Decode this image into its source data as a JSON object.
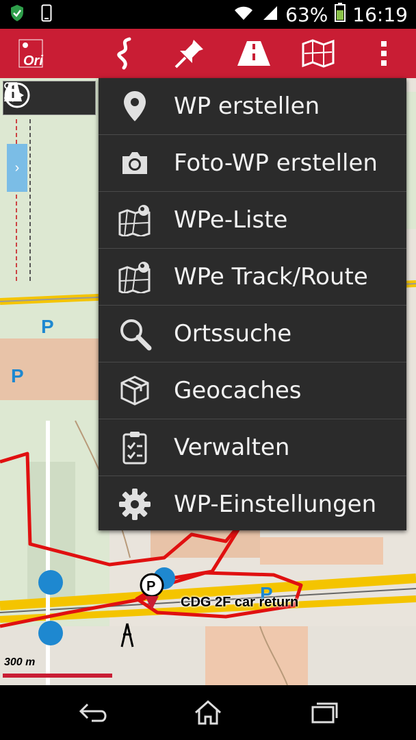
{
  "status_bar": {
    "battery_percent": "63%",
    "time": "16:19",
    "icons": [
      "shield-check-icon",
      "phone-outline-icon",
      "wifi-icon",
      "signal-icon",
      "battery-icon"
    ]
  },
  "app_bar": {
    "logo_text": "Ori",
    "tools": [
      "route-icon",
      "pin-icon",
      "road-icon",
      "map-icon",
      "overflow-menu-icon"
    ],
    "accent": "#c91d34"
  },
  "map": {
    "tools": [
      "graph-icon",
      "road-icon",
      "compass-arrow-icon"
    ],
    "side_tab": "›",
    "scale_label": "300 m",
    "place_label": "CDG 2F car return"
  },
  "menu": {
    "items": [
      {
        "label": "WP erstellen",
        "icon": "location-pin-icon"
      },
      {
        "label": "Foto-WP erstellen",
        "icon": "camera-icon"
      },
      {
        "label": "WPe-Liste",
        "icon": "map-list-icon"
      },
      {
        "label": "WPe Track/Route",
        "icon": "map-track-icon"
      },
      {
        "label": "Ortssuche",
        "icon": "search-icon"
      },
      {
        "label": "Geocaches",
        "icon": "geocache-box-icon"
      },
      {
        "label": "Verwalten",
        "icon": "clipboard-check-icon"
      },
      {
        "label": "WP-Einstellungen",
        "icon": "gear-icon"
      }
    ]
  },
  "nav_bar": {
    "buttons": [
      "back-icon",
      "home-icon",
      "recents-icon"
    ]
  }
}
